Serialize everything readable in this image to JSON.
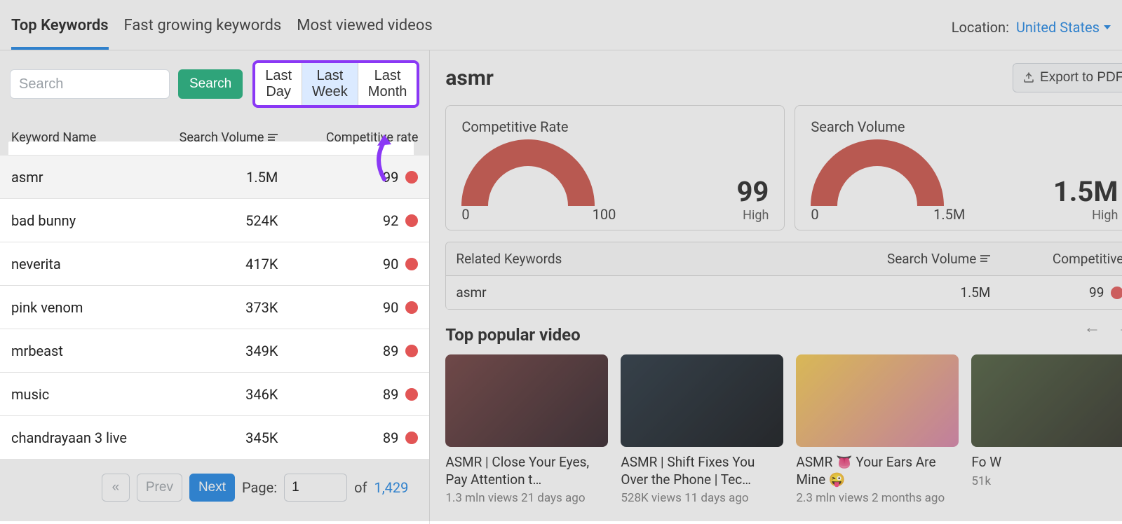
{
  "tabs": {
    "top": "Top Keywords",
    "fast": "Fast growing keywords",
    "most": "Most viewed videos"
  },
  "location": {
    "label": "Location:",
    "value": "United States"
  },
  "search": {
    "placeholder": "Search",
    "button": "Search"
  },
  "period": {
    "day": "Last Day",
    "week": "Last Week",
    "month": "Last Month"
  },
  "table": {
    "headers": {
      "name": "Keyword Name",
      "volume": "Search Volume",
      "competitive": "Competitive rate"
    },
    "rows": [
      {
        "name": "asmr",
        "volume": "1.5M",
        "comp": "99"
      },
      {
        "name": "bad bunny",
        "volume": "524K",
        "comp": "92"
      },
      {
        "name": "neverita",
        "volume": "417K",
        "comp": "90"
      },
      {
        "name": "pink venom",
        "volume": "373K",
        "comp": "90"
      },
      {
        "name": "mrbeast",
        "volume": "349K",
        "comp": "89"
      },
      {
        "name": "music",
        "volume": "346K",
        "comp": "89"
      },
      {
        "name": "chandrayaan 3 live",
        "volume": "345K",
        "comp": "89"
      }
    ]
  },
  "pager": {
    "prev": "Prev",
    "next": "Next",
    "page_label": "Page:",
    "page": "1",
    "of": "of",
    "total": "1,429"
  },
  "detail": {
    "title": "asmr",
    "export": "Export to PDF",
    "cards": {
      "competitive": {
        "title": "Competitive Rate",
        "min": "0",
        "max": "100",
        "value": "99",
        "label": "High"
      },
      "volume": {
        "title": "Search Volume",
        "min": "0",
        "max": "1.5M",
        "value": "1.5M",
        "label": "High"
      }
    },
    "related": {
      "headers": {
        "name": "Related Keywords",
        "volume": "Search Volume",
        "competitive": "Competitive"
      },
      "rows": [
        {
          "name": "asmr",
          "volume": "1.5M",
          "comp": "99"
        }
      ]
    },
    "popular": {
      "title": "Top popular video",
      "videos": [
        {
          "title": "ASMR | Close Your Eyes, Pay Attention t…",
          "meta": "1.3 mln views 21 days ago"
        },
        {
          "title": "ASMR | Shift Fixes You Over the Phone | Tec…",
          "meta": "528K views 11 days ago"
        },
        {
          "title": "ASMR 👅 Your Ears Are Mine 😜",
          "meta": "2.3 mln views 2 months ago"
        },
        {
          "title": "Fo W",
          "meta": "51k"
        }
      ]
    }
  }
}
